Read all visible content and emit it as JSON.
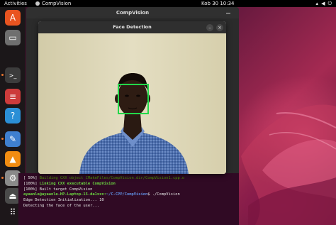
{
  "topbar": {
    "activities": "Activities",
    "app_name": "CompVision",
    "clock": "Kob 30  10:34"
  },
  "main_window": {
    "title": "CompVision"
  },
  "dialog": {
    "title": "Face Detection"
  },
  "dock": {
    "items": [
      {
        "name": "software-center",
        "color": "#e95420",
        "glyph": "A"
      },
      {
        "name": "files",
        "color": "#6f6f6f",
        "glyph": "▭"
      },
      {
        "name": "terminal",
        "color": "#3c3c3c",
        "glyph": ">_"
      },
      {
        "name": "text-editor",
        "color": "#cc3b3b",
        "glyph": "≡"
      },
      {
        "name": "help",
        "color": "#2b8fd6",
        "glyph": "?"
      },
      {
        "name": "notes",
        "color": "#3f7fcf",
        "glyph": "✎"
      },
      {
        "name": "vlc",
        "color": "#f28c12",
        "glyph": "▲"
      },
      {
        "name": "settings",
        "color": "#8a8a8a",
        "glyph": "⚙"
      },
      {
        "name": "drive",
        "color": "#4a4a4a",
        "glyph": "⏏"
      },
      {
        "name": "app-grid",
        "color": "transparent",
        "glyph": "⠿"
      }
    ]
  },
  "terminal": {
    "lines": [
      {
        "p1": "[ 50%] ",
        "t1": "Building CXX object CMakeFiles/CompVision.dir/CompVision1.cpp.o",
        "p2": "",
        "t2": ""
      },
      {
        "p1": "[100%] ",
        "t1": "Linking CXX executable CompVision",
        "p2": "",
        "t2": ""
      },
      {
        "p1": "[100%] ",
        "t1": "Built target CompVision",
        "p2": "",
        "t2": ""
      },
      {
        "p1": "",
        "t1": "",
        "p2": "ayaanle@ayaanle-HP-Laptop-15-da1xxx:~/C-CPP/CompVision",
        "t2": "$ ./CompVision"
      },
      {
        "p1": "",
        "t1": "Edge Detection Initialization... 10",
        "p2": "",
        "t2": ""
      },
      {
        "p1": "",
        "t1": "Detecting the face of the user...",
        "p2": "",
        "t2": ""
      }
    ]
  },
  "colors": {
    "detection_box": "#22d84a",
    "terminal_bg": "#300a24",
    "shirt": "#4a6aa8"
  }
}
